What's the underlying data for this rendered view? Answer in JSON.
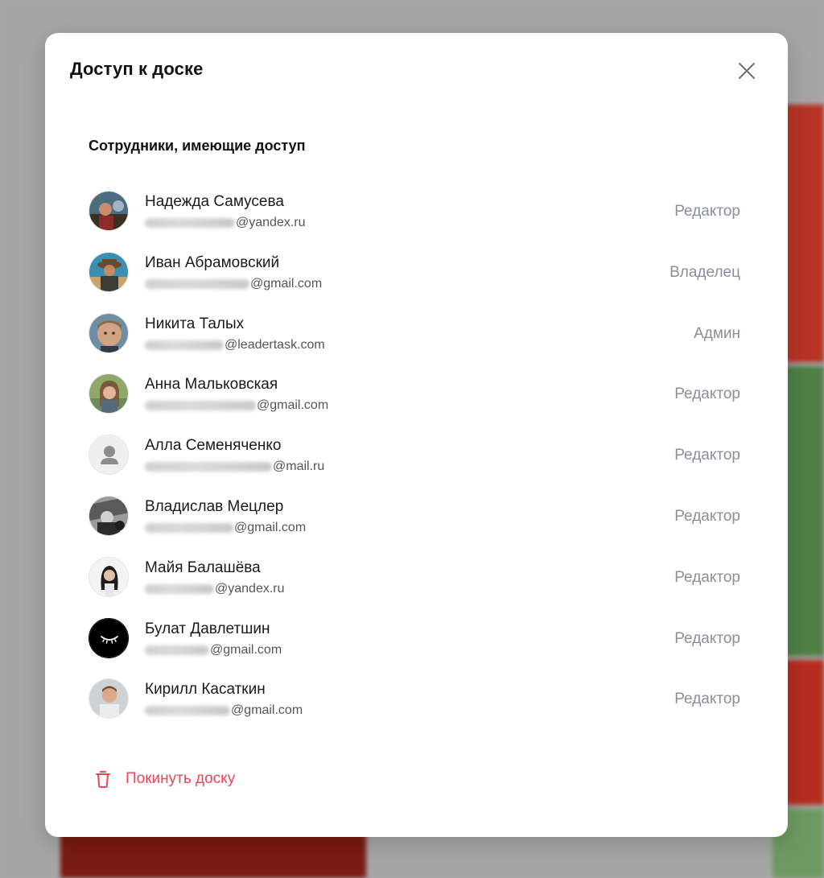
{
  "dialog": {
    "title": "Доступ к доске",
    "section_title": "Сотрудники, имеющие доступ",
    "close_icon": "close-icon",
    "leave_label": "Покинуть доску",
    "leave_icon": "trash-icon",
    "accent_color": "#ef4456"
  },
  "members": [
    {
      "name": "Надежда Самусева",
      "email_domain": "@yandex.ru",
      "role": "Редактор",
      "avatar_icon": "user-photo-avatar"
    },
    {
      "name": "Иван Абрамовский",
      "email_domain": "@gmail.com",
      "role": "Владелец",
      "avatar_icon": "user-photo-avatar"
    },
    {
      "name": "Никита Талых",
      "email_domain": "@leadertask.com",
      "role": "Админ",
      "avatar_icon": "user-photo-avatar"
    },
    {
      "name": "Анна Мальковская",
      "email_domain": "@gmail.com",
      "role": "Редактор",
      "avatar_icon": "user-photo-avatar"
    },
    {
      "name": "Алла Семеняченко",
      "email_domain": "@mail.ru",
      "role": "Редактор",
      "avatar_icon": "default-user-avatar"
    },
    {
      "name": "Владислав Мецлер",
      "email_domain": "@gmail.com",
      "role": "Редактор",
      "avatar_icon": "user-photo-avatar"
    },
    {
      "name": "Майя Балашёва",
      "email_domain": "@yandex.ru",
      "role": "Редактор",
      "avatar_icon": "user-photo-avatar"
    },
    {
      "name": "Булат Давлетшин",
      "email_domain": "@gmail.com",
      "role": "Редактор",
      "avatar_icon": "eye-logo-avatar"
    },
    {
      "name": "Кирилл Касаткин",
      "email_domain": "@gmail.com",
      "role": "Редактор",
      "avatar_icon": "user-photo-avatar"
    }
  ]
}
